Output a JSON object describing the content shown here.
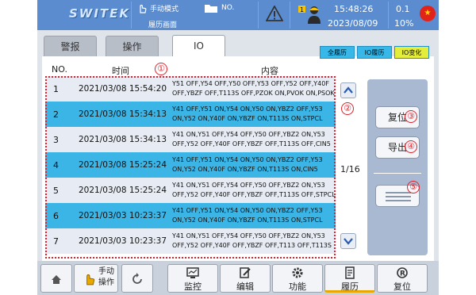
{
  "topbar": {
    "brand": "SWITEK",
    "mode": "手动模式",
    "page": "履历画面",
    "no_label": "NO.",
    "time": "15:48:26",
    "date": "2023/08/09",
    "speed": "0.1",
    "percent": "10%"
  },
  "tabs": [
    {
      "label": "警报"
    },
    {
      "label": "操作"
    },
    {
      "label": "IO"
    }
  ],
  "subtabs": [
    {
      "label": "全履历"
    },
    {
      "label": "IO履历"
    },
    {
      "label": "IO变化"
    }
  ],
  "table": {
    "headers": {
      "no": "NO.",
      "time": "时间",
      "content": "内容"
    },
    "rows": [
      {
        "no": "1",
        "time": "2021/03/08 15:54:20",
        "line1": "Y51 OFF,Y54 OFF,Y50 OFF,Y53 OFF,Y52 OFF,Y40F",
        "line2": "OFF,YBZF OFF,T113S OFF,PZOK ON,PVOK ON,PSOK"
      },
      {
        "no": "2",
        "time": "2021/03/08 15:34:13",
        "line1": "Y41 OFF,Y51 ON,Y54 ON,Y50 ON,YBZ2 OFF,Y53",
        "line2": "ON,Y52 ON,Y40F ON,YBZF ON,T113S ON,STPCL"
      },
      {
        "no": "3",
        "time": "2021/03/08 15:34:13",
        "line1": "Y41 ON,Y51 OFF,Y54 OFF,Y50 OFF,YBZ2 ON,Y53",
        "line2": "OFF,Y52 OFF,Y40F OFF,YBZF OFF,T113S OFF,CIN5"
      },
      {
        "no": "4",
        "time": "2021/03/08 15:25:24",
        "line1": "Y41 OFF,Y51 ON,Y54 ON,Y50 ON,YBZ2 OFF,Y53",
        "line2": "ON,Y52 ON,Y40F ON,YBZF ON,T113S ON,CIN5"
      },
      {
        "no": "5",
        "time": "2021/03/08 15:25:24",
        "line1": "Y41 ON,Y51 OFF,Y54 OFF,Y50 OFF,YBZ2 ON,Y53",
        "line2": "OFF,Y52 OFF,Y40F OFF,YBZF OFF,T113S OFF,STPCL"
      },
      {
        "no": "6",
        "time": "2021/03/03 10:23:37",
        "line1": "Y41 OFF,Y51 ON,Y54 ON,Y50 ON,YBZ2 OFF,Y53",
        "line2": "ON,Y52 ON,Y40F ON,YBZF ON,T113S ON,STPCL"
      },
      {
        "no": "7",
        "time": "2021/03/03 10:23:37",
        "line1": "Y41 ON,Y51 OFF,Y54 OFF,Y50 OFF,YBZ2 ON,Y53",
        "line2": "OFF,Y52 OFF,Y40F OFF,YBZF OFF,T113 OFF,T113S"
      }
    ]
  },
  "pagination": {
    "page": "1/16"
  },
  "panel": {
    "reset_label": "复位",
    "export_label": "导出"
  },
  "callouts": {
    "c1": "①",
    "c2": "②",
    "c3": "③",
    "c4": "④",
    "c5": "⑤"
  },
  "bottom": {
    "manual_line1": "手动",
    "manual_line2": "操作",
    "monitor": "监控",
    "edit": "编辑",
    "function": "功能",
    "history": "履历",
    "reset": "复位"
  },
  "colors": {
    "topbar": "#5a8ccf",
    "row_highlight": "#3bb5e6",
    "row_plain": "#e7ecf4",
    "subtab_active": "#e3ed3a",
    "callout": "#e0212b"
  }
}
